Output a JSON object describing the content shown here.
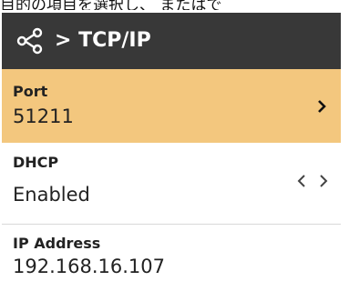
{
  "caption": "目的の項目を選択し、 またはで",
  "header": {
    "icon": "share-icon",
    "title": "> TCP/IP"
  },
  "rows": [
    {
      "label": "Port",
      "value": "51211",
      "selected": true,
      "control": "chevron-right"
    },
    {
      "label": "DHCP",
      "value": "Enabled",
      "selected": false,
      "control": "chevron-left-right"
    },
    {
      "label": "IP Address",
      "value": "192.168.16.107",
      "selected": false,
      "control": "none"
    }
  ],
  "colors": {
    "header_bg": "#383838",
    "selected_bg": "#f3c77e",
    "text": "#222222"
  }
}
